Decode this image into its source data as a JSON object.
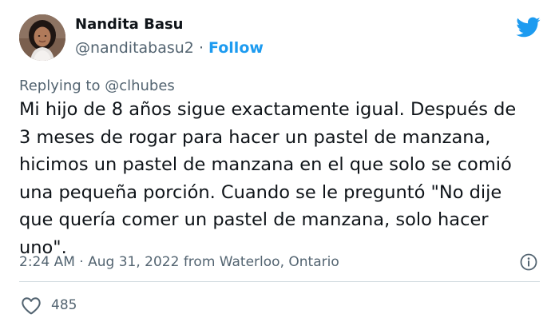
{
  "author": {
    "name": "Nandita Basu",
    "handle": "@nanditabasu2",
    "separator": " · ",
    "follow_label": "Follow"
  },
  "reply": {
    "prefix": "Replying to ",
    "mention": "@clhubes"
  },
  "tweet": {
    "text": "Mi hijo de 8 años sigue exactamente igual. Después de 3 meses de rogar para hacer un pastel de manzana, hicimos un pastel de manzana en el que solo se comió una pequeña porción. Cuando se le preguntó \"No dije que quería comer un pastel de manzana, solo hacer uno\".",
    "lines": [
      "Mi hijo de 8 años sigue exactamente igual. Después de",
      "3 meses de rogar para hacer un pastel de manzana,",
      "hicimos un pastel de manzana en el que solo se comió",
      "una pequeña porción. Cuando se le preguntó \"No dije",
      "que quería comer un pastel de manzana, solo hacer",
      "uno\"."
    ]
  },
  "meta": {
    "time": "2:24 AM",
    "separator": " · ",
    "date": "Aug 31, 2022",
    "source": " from Waterloo, Ontario"
  },
  "stats": {
    "likes": "485"
  },
  "icons": {
    "brand": "twitter-bird-icon",
    "info": "info-icon",
    "like": "heart-icon"
  },
  "colors": {
    "brand_blue": "#1d9bf0",
    "text_primary": "#0f1419",
    "text_secondary": "#536471",
    "divider": "#cfd9de"
  }
}
